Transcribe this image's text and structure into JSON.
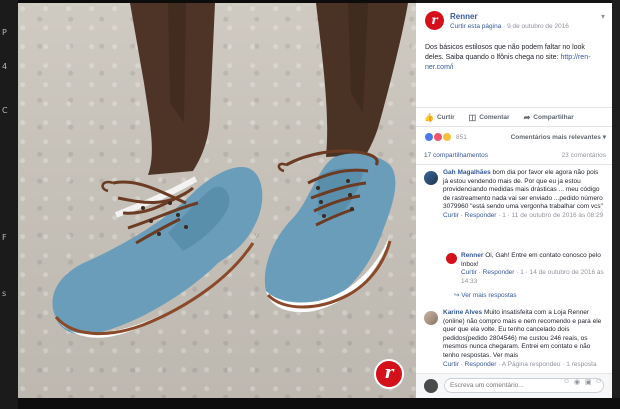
{
  "post": {
    "page_name": "Renner",
    "like_page_label": "Curtir esta página",
    "date": "9 de outubro de 2016",
    "text": "Dos básicos estilosos que não podem faltar no look deles. Saiba quando o lfônis chega no site:",
    "link": "http://ren-ner.com/i"
  },
  "actions": {
    "like": "Curtir",
    "comment": "Comentar",
    "share": "Compartilhar"
  },
  "reactions": {
    "count": "851",
    "sort_label": "Comentários mais relevantes"
  },
  "counts": {
    "shares": "17 compartilhamentos",
    "comments": "23 comentários"
  },
  "comments": [
    {
      "author": "Gah Magalhães",
      "text": "bom dia por favor ele agora não pois já estou vendendo mais de. Por que eu ja estou providenciando medidas mais drásticas ... meu código de rastreamento nada vai ser enviado ...pedido número 3079960 \"está sendo uma vergonha trabalhar com vcs\"",
      "reply_label": "Curtir · Responder",
      "time": "1 · 11 de outubro de 2016 às 08:29"
    },
    {
      "author": "Renner",
      "text": "Oi, Gah! Entre em contato conosco pelo Inbox!",
      "reply_label": "Curtir · Responder",
      "time": "1 · 14 de outubro de 2016 às 14:33"
    },
    {
      "author": "Karine Alves",
      "text": "Muito insatisfeita com a Loja Renner (online) não compro mais e nem recomendo e para ele quer que ela volte. Eu tenho cancelado dois pedidos(pedido 2804546) me custou 246 reais, os mesmos nunca chegaram. Entrei em contato e não tenho respostas. Ver mais",
      "reply_label": "Curtir · Responder",
      "time": "A Página respondeu · 1 resposta"
    }
  ],
  "more_replies": "Ver mais respostas",
  "write_comment_placeholder": "Escreva um comentário...",
  "left_edge": [
    "P",
    "4",
    "C",
    "F",
    "s"
  ],
  "colors": {
    "brand": "#d4101b",
    "link": "#365899",
    "shoe": "#6a9db9"
  }
}
